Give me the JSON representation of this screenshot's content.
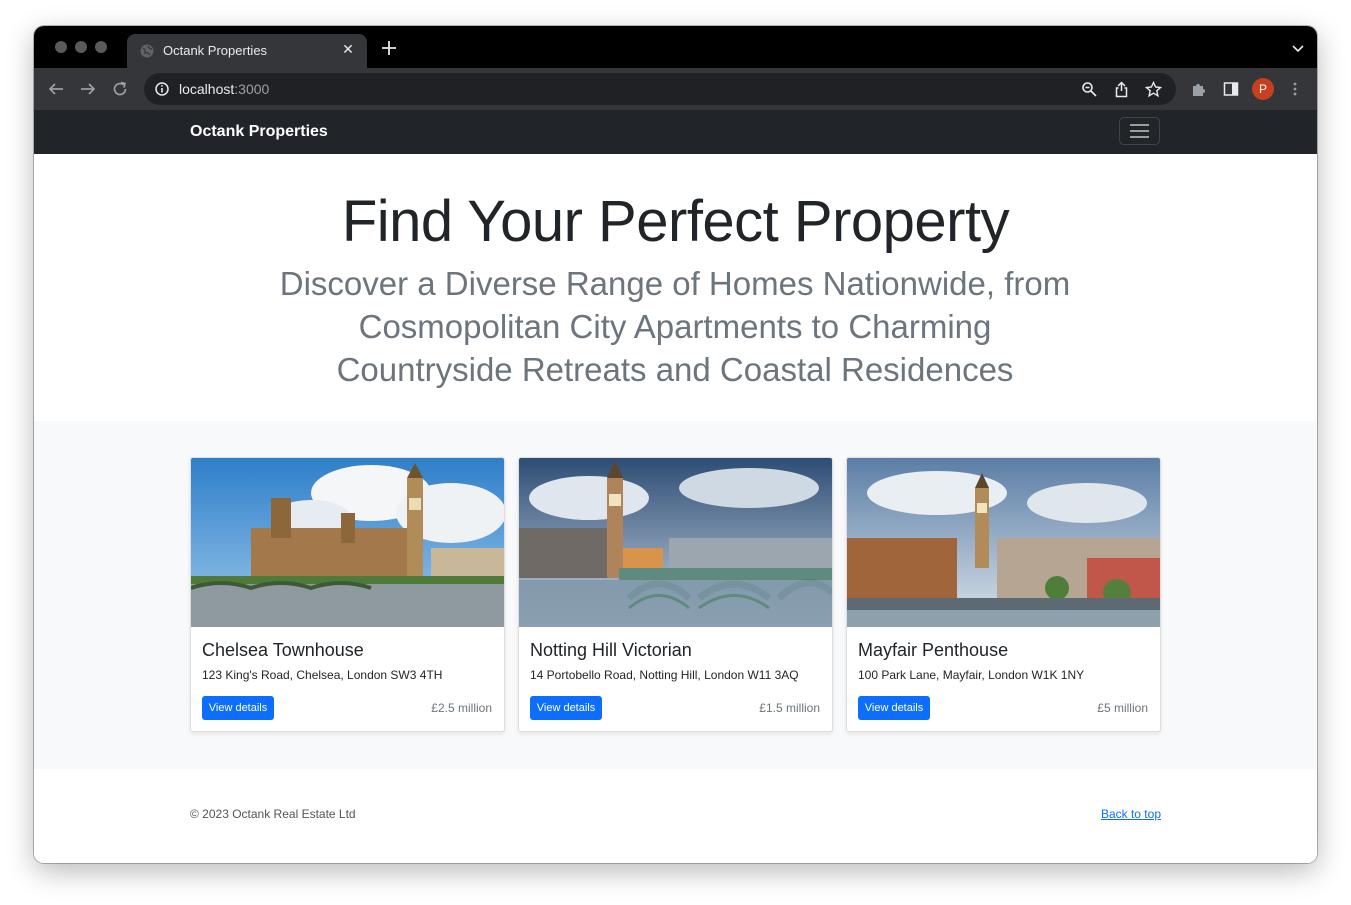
{
  "browser": {
    "tab_title": "Octank Properties",
    "tab_close": "✕",
    "url_host": "localhost",
    "url_port": ":3000",
    "avatar_letter": "P"
  },
  "navbar": {
    "brand": "Octank Properties"
  },
  "hero": {
    "title": "Find Your Perfect Property",
    "subtitle": "Discover a Diverse Range of Homes Nationwide, from Cosmopolitan City Apartments to Charming Countryside Retreats and Coastal Residences"
  },
  "listings": [
    {
      "title": "Chelsea Townhouse",
      "address": "123 King's Road, Chelsea, London SW3 4TH",
      "button": "View details",
      "price": "£2.5 million",
      "image": "westminster-palace-big-ben-photo"
    },
    {
      "title": "Notting Hill Victorian",
      "address": "14 Portobello Road, Notting Hill, London W11 3AQ",
      "button": "View details",
      "price": "£1.5 million",
      "image": "westminster-bridge-big-ben-photo"
    },
    {
      "title": "Mayfair Penthouse",
      "address": "100 Park Lane, Mayfair, London W1K 1NY",
      "button": "View details",
      "price": "£5 million",
      "image": "london-skyline-aerial-photo"
    }
  ],
  "footer": {
    "copyright": "© 2023 Octank Real Estate Ltd",
    "back_to_top": "Back to top"
  },
  "colors": {
    "navbar_bg": "#212529",
    "primary": "#0d6efd",
    "album_bg": "#f8f9fa",
    "avatar_bg": "#c5401e"
  }
}
